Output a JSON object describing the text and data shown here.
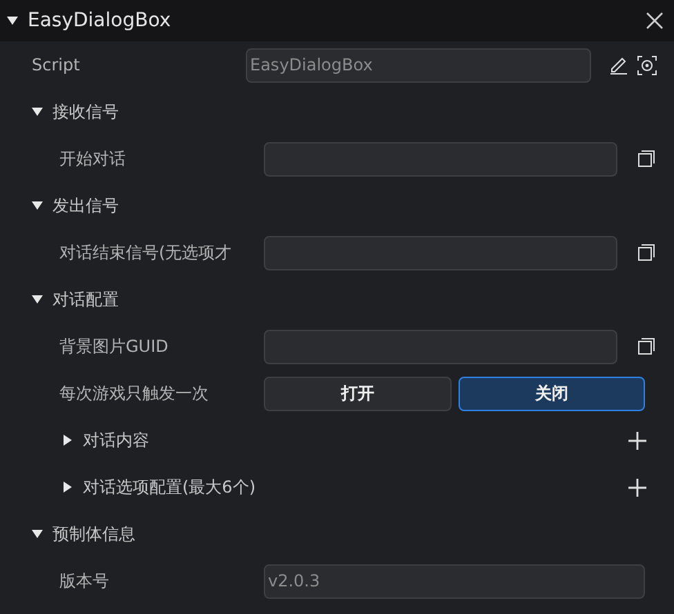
{
  "panel": {
    "title": "EasyDialogBox",
    "expanded": true
  },
  "script": {
    "label": "Script",
    "value": "EasyDialogBox"
  },
  "sections": [
    {
      "title": "接收信号",
      "expanded": true,
      "rows": [
        {
          "kind": "field",
          "label": "开始对话"
        }
      ]
    },
    {
      "title": "发出信号",
      "expanded": true,
      "rows": [
        {
          "kind": "field",
          "label": "对话结束信号(无选项才"
        }
      ]
    },
    {
      "title": "对话配置",
      "expanded": true,
      "rows": [
        {
          "kind": "field",
          "label": "背景图片GUID"
        },
        {
          "kind": "toggle",
          "label": "每次游戏只触发一次",
          "options": [
            {
              "label": "打开",
              "selected": false
            },
            {
              "label": "关闭",
              "selected": true
            }
          ]
        },
        {
          "kind": "list",
          "label": "对话内容",
          "expanded": false
        },
        {
          "kind": "list",
          "label": "对话选项配置(最大6个)",
          "expanded": false
        }
      ]
    },
    {
      "title": "预制体信息",
      "expanded": true,
      "rows": [
        {
          "kind": "readonly",
          "label": "版本号",
          "value": "v2.0.3"
        }
      ]
    }
  ]
}
